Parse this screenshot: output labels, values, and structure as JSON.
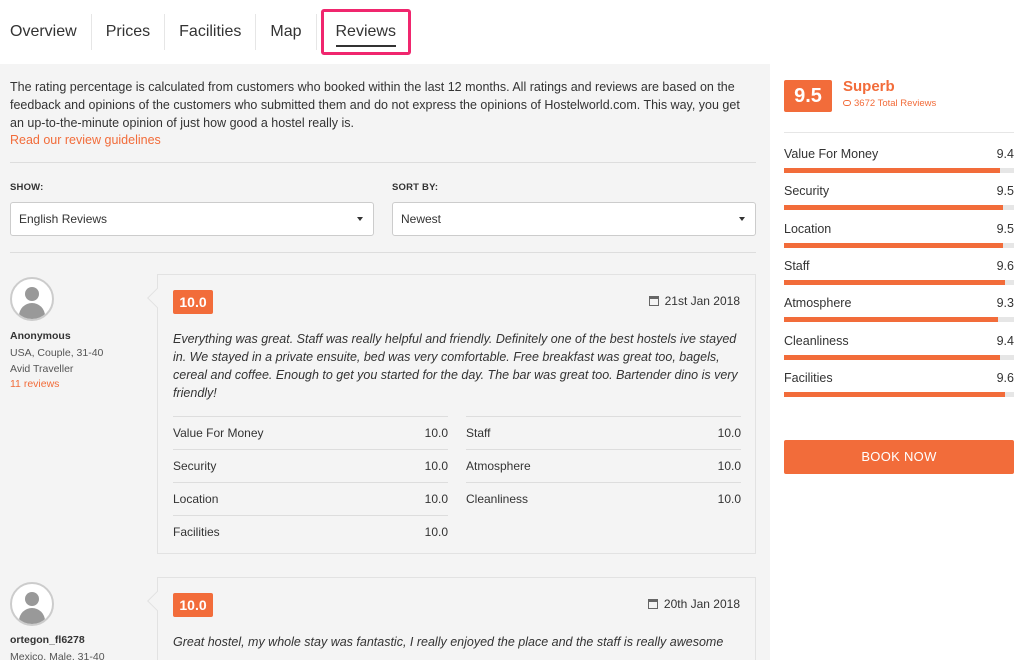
{
  "tabs": [
    "Overview",
    "Prices",
    "Facilities",
    "Map",
    "Reviews"
  ],
  "intro": {
    "text": "The rating percentage is calculated from customers who booked within the last 12 months. All ratings and reviews are based on the feedback and opinions of the customers who submitted them and do not express the opinions of Hostelworld.com. This way, you get an up-to-the-minute opinion of just how good a hostel really is.",
    "link": "Read our review guidelines"
  },
  "filters": {
    "show_label": "SHOW:",
    "show_value": "English Reviews",
    "sort_label": "SORT BY:",
    "sort_value": "Newest"
  },
  "reviews": [
    {
      "name": "Anonymous",
      "meta1": "USA, Couple, 31-40",
      "meta2": "Avid Traveller",
      "count": "11 reviews",
      "score": "10.0",
      "date": "21st Jan 2018",
      "text": "Everything was great. Staff was really helpful and friendly. Definitely one of the best hostels ive stayed in. We stayed in a private ensuite, bed was very comfortable. Free breakfast was great too, bagels, cereal and coffee. Enough to get you started for the day. The bar was great too. Bartender dino is very friendly!",
      "subs": [
        {
          "label": "Value For Money",
          "value": "10.0"
        },
        {
          "label": "Staff",
          "value": "10.0"
        },
        {
          "label": "Security",
          "value": "10.0"
        },
        {
          "label": "Atmosphere",
          "value": "10.0"
        },
        {
          "label": "Location",
          "value": "10.0"
        },
        {
          "label": "Cleanliness",
          "value": "10.0"
        },
        {
          "label": "Facilities",
          "value": "10.0"
        }
      ]
    },
    {
      "name": "ortegon_fl6278",
      "meta1": "Mexico, Male, 31-40",
      "score": "10.0",
      "date": "20th Jan 2018",
      "text": "Great hostel, my whole stay was fantastic, I really enjoyed the place and the staff is really awesome"
    }
  ],
  "summary": {
    "score": "9.5",
    "rating_word": "Superb",
    "total": "3672 Total Reviews",
    "categories": [
      {
        "label": "Value For Money",
        "value": "9.4",
        "fill": 0.94
      },
      {
        "label": "Security",
        "value": "9.5",
        "fill": 0.95
      },
      {
        "label": "Location",
        "value": "9.5",
        "fill": 0.95
      },
      {
        "label": "Staff",
        "value": "9.6",
        "fill": 0.96
      },
      {
        "label": "Atmosphere",
        "value": "9.3",
        "fill": 0.93
      },
      {
        "label": "Cleanliness",
        "value": "9.4",
        "fill": 0.94
      },
      {
        "label": "Facilities",
        "value": "9.6",
        "fill": 0.96
      }
    ],
    "book_label": "BOOK NOW"
  },
  "colors": {
    "accent": "#f26c3a",
    "highlight": "#f0266e"
  }
}
